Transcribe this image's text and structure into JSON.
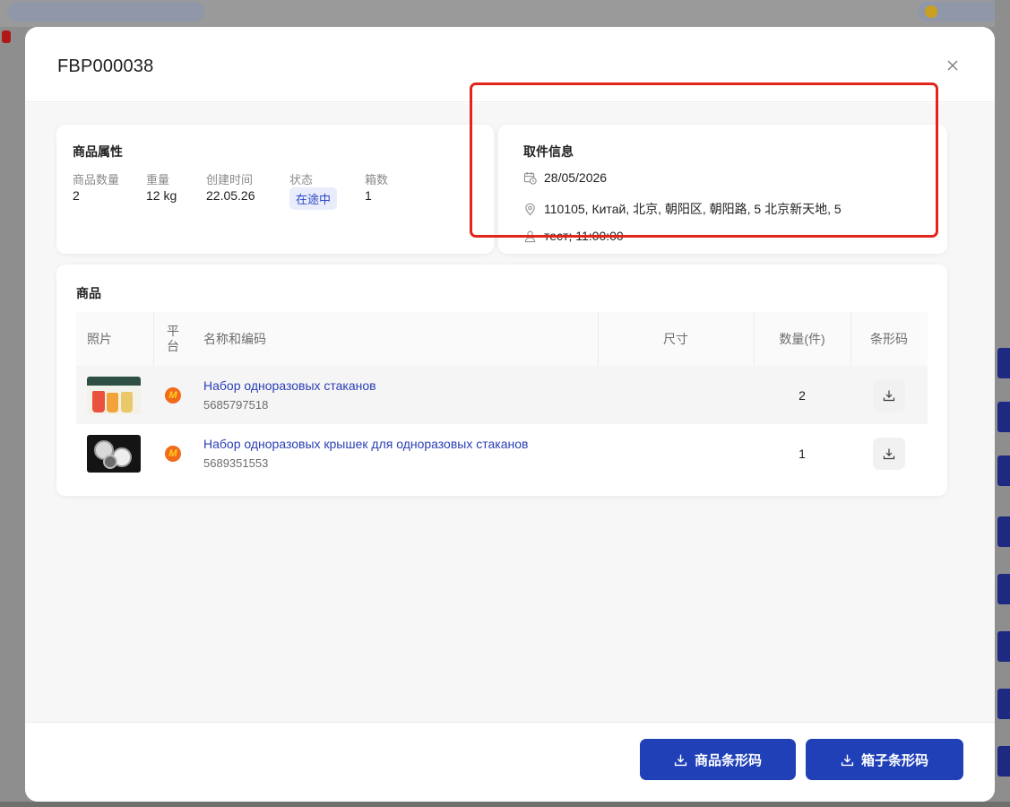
{
  "modal": {
    "title": "FBP000038"
  },
  "attributes": {
    "title": "商品属性",
    "fields": [
      {
        "label": "商品数量",
        "value": "2"
      },
      {
        "label": "重量",
        "value": "12 kg"
      },
      {
        "label": "创建时间",
        "value": "22.05.26"
      },
      {
        "label": "状态",
        "value": "在途中"
      },
      {
        "label": "箱数",
        "value": "1"
      }
    ]
  },
  "pickup": {
    "title": "取件信息",
    "date": "28/05/2026",
    "address": "110105, Китай, 北京, 朝阳区, 朝阳路, 5 北京新天地, 5",
    "contact": "тест; 11:00:00"
  },
  "goods": {
    "title": "商品",
    "columns": {
      "photo": "照片",
      "platform_line1": "平",
      "platform_line2": "台",
      "name": "名称和编码",
      "size": "尺寸",
      "qty": "数量(件)",
      "barcode": "条形码"
    },
    "rows": [
      {
        "name": "Набор одноразовых стаканов",
        "code": "5685797518",
        "size": "",
        "qty": "2",
        "platform_icon": "yandex-market-icon"
      },
      {
        "name": "Набор одноразовых крышек для одноразовых стаканов",
        "code": "5689351553",
        "size": "",
        "qty": "1",
        "platform_icon": "yandex-market-icon"
      }
    ]
  },
  "footer": {
    "product_barcode_label": "商品条形码",
    "box_barcode_label": "箱子条形码"
  },
  "colors": {
    "primary": "#2040b8",
    "link": "#2a3fb5",
    "highlight": "#e0251b",
    "badge_bg": "#e9edfb"
  }
}
